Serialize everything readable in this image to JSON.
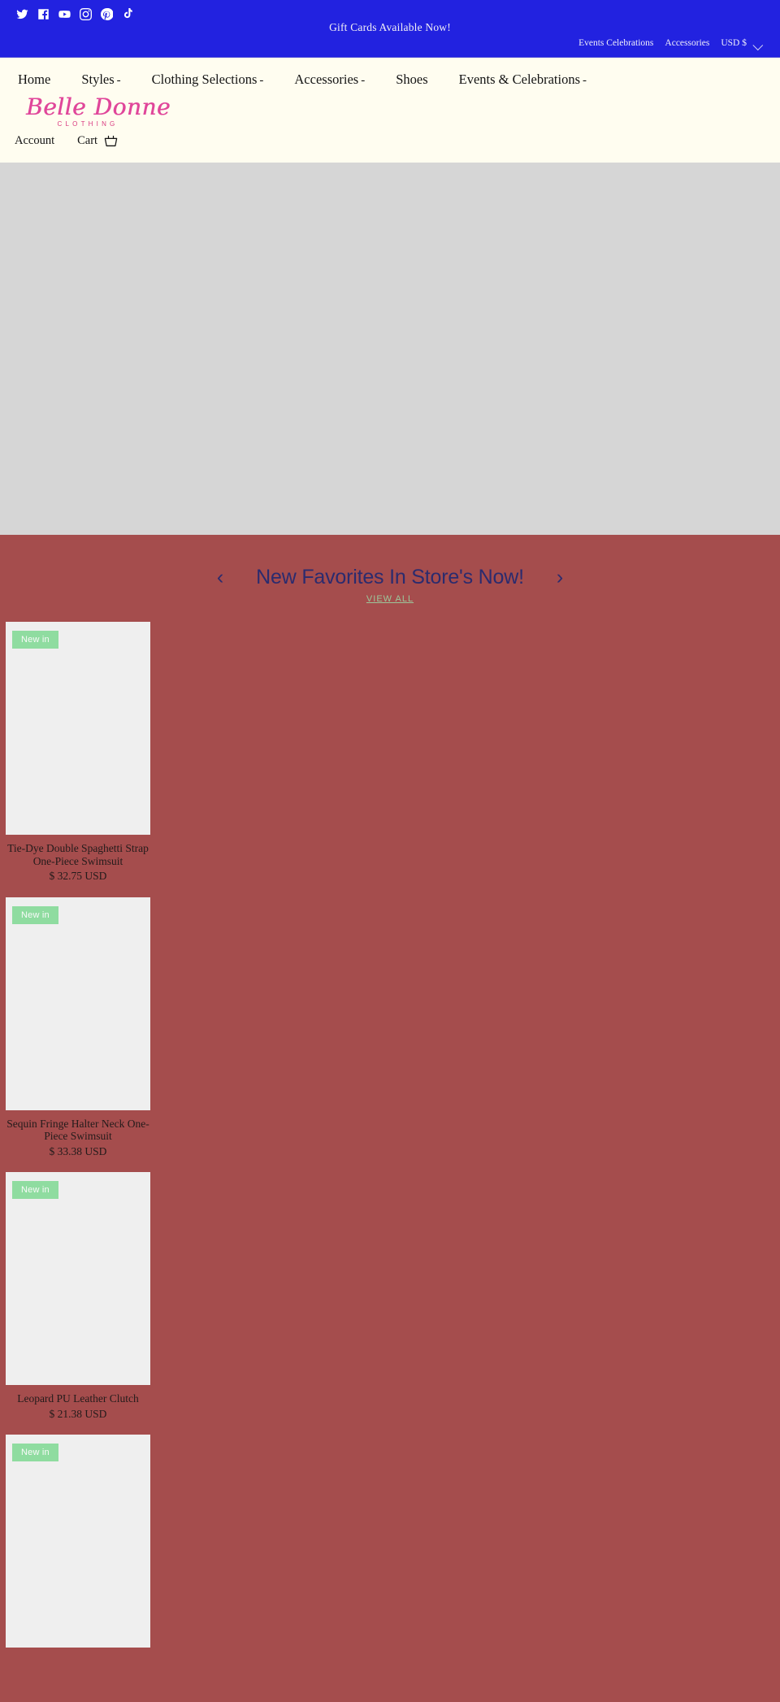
{
  "announcement": {
    "message": "Gift Cards Available Now!",
    "social": [
      {
        "name": "twitter-icon"
      },
      {
        "name": "facebook-icon"
      },
      {
        "name": "youtube-icon"
      },
      {
        "name": "instagram-icon"
      },
      {
        "name": "pinterest-icon"
      },
      {
        "name": "tiktok-icon"
      }
    ],
    "links": [
      {
        "label": "Events Celebrations"
      },
      {
        "label": "Accessories"
      }
    ],
    "currency": "USD $",
    "bg_color": "#2222e0"
  },
  "header": {
    "nav": [
      {
        "label": "Home",
        "has_caret": false
      },
      {
        "label": "Styles",
        "has_caret": true
      },
      {
        "label": "Clothing Selections",
        "has_caret": true
      },
      {
        "label": "Accessories",
        "has_caret": true
      },
      {
        "label": "Shoes",
        "has_caret": false
      },
      {
        "label": "Events & Celebrations",
        "has_caret": true
      }
    ],
    "logo": {
      "name": "Belle Donne",
      "tagline": "CLOTHING",
      "color": "#e0469a"
    },
    "utility": [
      {
        "label": "Account"
      },
      {
        "label": "Cart"
      }
    ],
    "bg_color": "#fffdf0"
  },
  "hero": {
    "placeholder_color": "#d6d6d6"
  },
  "collection": {
    "title": "New Favorites In Store's Now!",
    "view_all_label": "VIEW ALL",
    "prev_arrow": "‹",
    "next_arrow": "›",
    "bg_color": "#a54d4d",
    "title_color": "#2b2b6e",
    "badge_color": "#8fdca0",
    "products": [
      {
        "badge": "New in",
        "title": "Tie-Dye Double Spaghetti Strap One-Piece Swimsuit",
        "price": "$ 32.75 USD"
      },
      {
        "badge": "New in",
        "title": "Sequin Fringe Halter Neck One-Piece Swimsuit",
        "price": "$ 33.38 USD"
      },
      {
        "badge": "New in",
        "title": "Leopard PU Leather Clutch",
        "price": "$ 21.38 USD"
      },
      {
        "badge": "New in",
        "title": "",
        "price": ""
      }
    ]
  }
}
